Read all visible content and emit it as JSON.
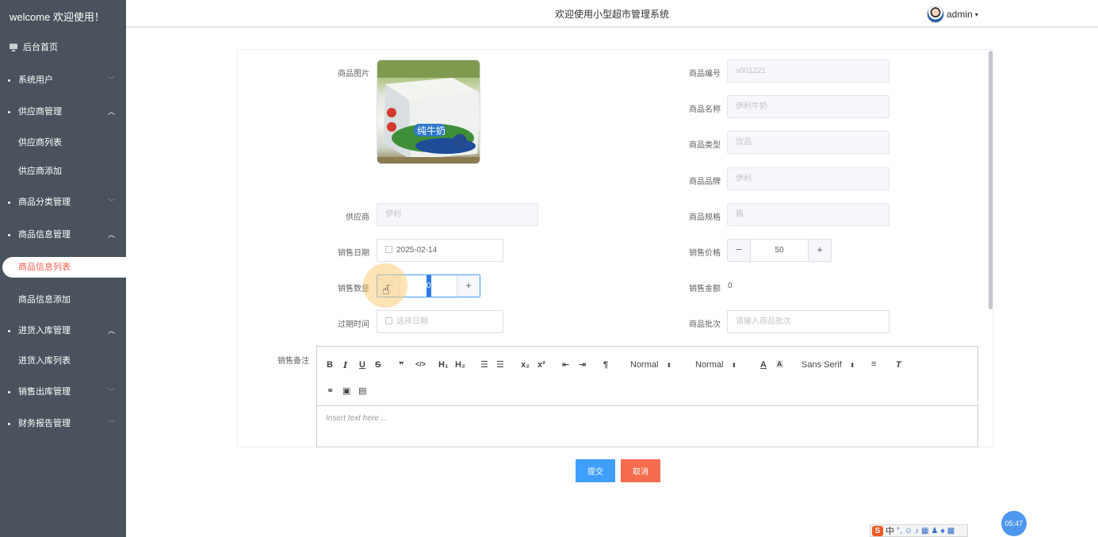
{
  "sidebar": {
    "title": "welcome 欢迎使用！",
    "items": [
      {
        "label": "后台首页"
      },
      {
        "label": "系统用户",
        "arrow": "﹀"
      },
      {
        "label": "供应商管理",
        "arrow": "︿"
      },
      {
        "label": "供应商列表"
      },
      {
        "label": "供应商添加"
      },
      {
        "label": "商品分类管理",
        "arrow": "﹀"
      },
      {
        "label": "商品信息管理",
        "arrow": "︿"
      },
      {
        "label": "商品信息列表"
      },
      {
        "label": "商品信息添加"
      },
      {
        "label": "进货入库管理",
        "arrow": "︿"
      },
      {
        "label": "进货入库列表"
      },
      {
        "label": "销售出库管理",
        "arrow": "﹀"
      },
      {
        "label": "财务报告管理",
        "arrow": "﹀"
      }
    ]
  },
  "header": {
    "title": "欢迎使用小型超市管理系统",
    "user": "admin"
  },
  "form": {
    "image_label": "商品图片",
    "code_label": "商品编号",
    "code_value": "s001221",
    "name_label": "商品名称",
    "name_value": "伊利牛奶",
    "type_label": "商品类型",
    "type_value": "饮品",
    "brand_label": "商品品牌",
    "brand_value": "伊利",
    "supplier_label": "供应商",
    "supplier_value": "伊利",
    "spec_label": "商品规格",
    "spec_value": "箱",
    "date_label": "销售日期",
    "date_value": "2025-02-14",
    "price_label": "销售价格",
    "price_value": "50",
    "qty_label": "销售数量",
    "qty_value": "0",
    "amount_label": "销售金额",
    "amount_value": "0",
    "expire_label": "过期时间",
    "expire_placeholder": "选择日期",
    "batch_label": "商品批次",
    "batch_placeholder": "请输入商品批次",
    "remark_label": "销售备注"
  },
  "editor": {
    "header_1": "H₁",
    "header_2": "H₂",
    "sub": "x₂",
    "sup": "x²",
    "size": "Normal",
    "header": "Normal",
    "font": "Sans Serif",
    "placeholder": "Insert text here ..."
  },
  "actions": {
    "submit": "提交",
    "cancel": "取消"
  },
  "taskbar": {
    "clock": "05:47",
    "ime_lang": "中"
  },
  "colors": {
    "sidebar_bg": "#4a535d",
    "active_text": "#f5604c",
    "primary": "#409eff",
    "danger": "#f56c4f"
  }
}
